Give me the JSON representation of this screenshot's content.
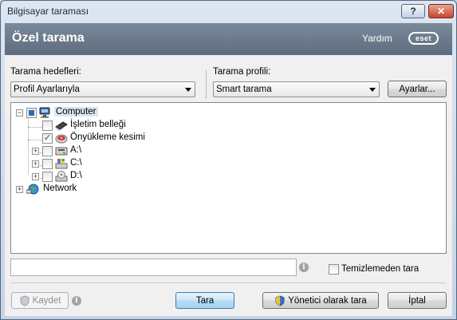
{
  "window": {
    "title": "Bilgisayar taraması",
    "help_glyph": "?",
    "close_glyph": "✕"
  },
  "header": {
    "title": "Özel tarama",
    "help_link": "Yardım",
    "logo_text": "eset"
  },
  "targets": {
    "label": "Tarama hedefleri:",
    "selected": "Profil Ayarlarıyla"
  },
  "profile": {
    "label": "Tarama profili:",
    "selected": "Smart tarama",
    "settings_button": "Ayarlar..."
  },
  "tree": {
    "computer": "Computer",
    "memory": "İşletim belleği",
    "boot": "Önyükleme kesimi",
    "drive_a": "A:\\",
    "drive_c": "C:\\",
    "drive_d": "D:\\",
    "network": "Network"
  },
  "path_input": {
    "value": ""
  },
  "no_clean": {
    "label": "Temizlemeden tara",
    "checked": false
  },
  "buttons": {
    "save": "Kaydet",
    "scan": "Tara",
    "scan_admin": "Yönetici olarak tara",
    "cancel": "İptal"
  },
  "glyphs": {
    "info": "i",
    "check": "✓",
    "expand_minus": "−",
    "expand_plus": "+"
  },
  "colors": {
    "header_bg": "#6b7a8b",
    "accent": "#3c7fb1"
  }
}
